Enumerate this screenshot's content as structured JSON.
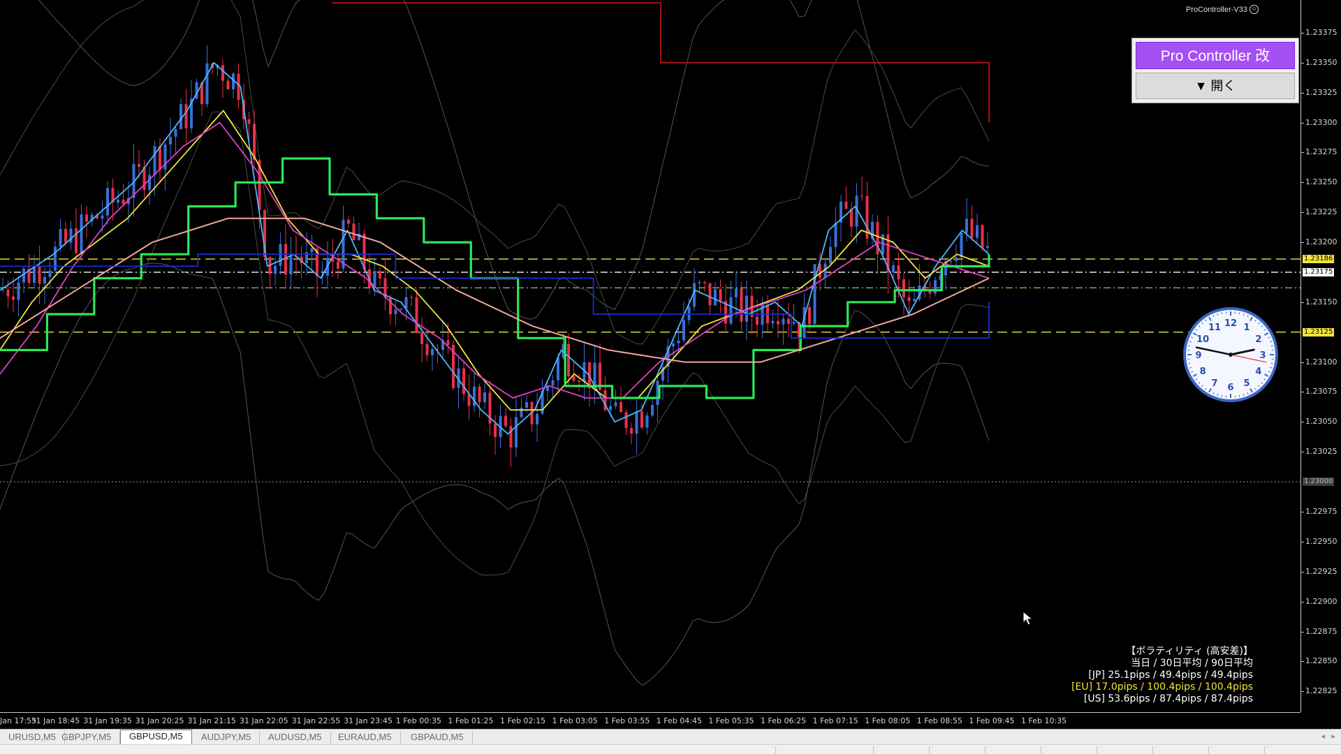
{
  "window": {
    "indicator_label": "ProController-V33",
    "current_symbol": "GBPUSD,M5"
  },
  "panel": {
    "title": "Pro Controller 改",
    "open_button": "▼ 開く",
    "title_color": "#a64ff5"
  },
  "price_axis": {
    "ticks": [
      "1.23375",
      "1.23350",
      "1.23325",
      "1.23300",
      "1.23275",
      "1.23250",
      "1.23225",
      "1.23200",
      "1.23150",
      "1.23100",
      "1.23075",
      "1.23050",
      "1.23025",
      "1.22975",
      "1.22950",
      "1.22925",
      "1.22900",
      "1.22875",
      "1.22850",
      "1.22825"
    ],
    "levels": [
      {
        "label": "1.23186",
        "color": "#f4e43c"
      },
      {
        "label": "1.23175",
        "color": "#ffffff"
      },
      {
        "label": "1.23125",
        "color": "#f4e43c"
      },
      {
        "label": "1.23000",
        "color": "#808080"
      }
    ]
  },
  "time_axis": {
    "ticks": [
      "Jan 17:55",
      "31 Jan 18:45",
      "31 Jan 19:35",
      "31 Jan 20:25",
      "31 Jan 21:15",
      "31 Jan 22:05",
      "31 Jan 22:55",
      "31 Jan 23:45",
      "1 Feb 00:35",
      "1 Feb 01:25",
      "1 Feb 02:15",
      "1 Feb 03:05",
      "1 Feb 03:55",
      "1 Feb 04:45",
      "1 Feb 05:35",
      "1 Feb 06:25",
      "1 Feb 07:15",
      "1 Feb 08:05",
      "1 Feb 08:55",
      "1 Feb 09:45",
      "1 Feb 10:35"
    ]
  },
  "tabs": [
    "URUSD,M5",
    "GBPJPY,M5",
    "GBPUSD,M5",
    "AUDJPY,M5",
    "AUDUSD,M5",
    "EURAUD,M5",
    "GBPAUD,M5"
  ],
  "active_tab": "GBPUSD,M5",
  "volatility": {
    "title": "【ボラティリティ (高安差)】",
    "header": "当日 / 30日平均 / 90日平均",
    "jp": "[JP] 25.1pips / 49.4pips / 49.4pips",
    "eu": "[EU] 17.0pips / 100.4pips / 100.4pips",
    "us": "[US] 53.6pips / 87.4pips / 87.4pips"
  },
  "clock": {
    "numbers": [
      "12",
      "1",
      "2",
      "3",
      "4",
      "5",
      "6",
      "7",
      "8",
      "9",
      "10",
      "11"
    ],
    "hour": 2.6,
    "minute": 47,
    "second": 17
  },
  "chart_data": {
    "type": "candlestick",
    "title": "GBPUSD,M5",
    "ylim": [
      1.2281,
      1.234
    ],
    "horizontal_levels": [
      {
        "price": 1.23186,
        "color": "#f4e43c",
        "style": "dashed"
      },
      {
        "price": 1.23175,
        "color": "#ffffff",
        "style": "dash-dot"
      },
      {
        "price": 1.23162,
        "color": "#7fd66e",
        "style": "dash-dot"
      },
      {
        "price": 1.23125,
        "color": "#f4e43c",
        "style": "dashed"
      },
      {
        "price": 1.23,
        "color": "#808080",
        "style": "dotted"
      }
    ],
    "bull_color": "#3a6fd8",
    "bear_color": "#e8304a",
    "series": [
      {
        "name": "ma_fast",
        "color": "#4cb8ff",
        "values": [
          1.2316,
          1.23175,
          1.2319,
          1.2321,
          1.2323,
          1.2325,
          1.2328,
          1.2331,
          1.2335,
          1.2333,
          1.2318,
          1.2319,
          1.2317,
          1.2321,
          1.2316,
          1.2315,
          1.2312,
          1.2309,
          1.2306,
          1.2304,
          1.2306,
          1.2311,
          1.2309,
          1.2305,
          1.2306,
          1.2311,
          1.2316,
          1.2315,
          1.2314,
          1.2315,
          1.2313,
          1.2321,
          1.2323,
          1.2319,
          1.2314,
          1.2318,
          1.2321,
          1.2319
        ]
      },
      {
        "name": "ma_mid",
        "color": "#f4e43c",
        "values": [
          1.2311,
          1.2315,
          1.2318,
          1.232,
          1.2322,
          1.2325,
          1.2328,
          1.2331,
          1.2327,
          1.2322,
          1.2319,
          1.2319,
          1.2318,
          1.2316,
          1.2313,
          1.2309,
          1.2306,
          1.2306,
          1.2309,
          1.2307,
          1.2307,
          1.231,
          1.2313,
          1.2314,
          1.2315,
          1.2316,
          1.2318,
          1.2321,
          1.232,
          1.2317,
          1.2319,
          1.2318
        ]
      },
      {
        "name": "ma_slow",
        "color": "#e040c8",
        "values": [
          1.2309,
          1.2313,
          1.2318,
          1.2322,
          1.2325,
          1.2328,
          1.233,
          1.2326,
          1.2321,
          1.2319,
          1.2317,
          1.2314,
          1.2312,
          1.2309,
          1.2307,
          1.2308,
          1.2307,
          1.2307,
          1.231,
          1.2312,
          1.2314,
          1.2315,
          1.2316,
          1.2318,
          1.232,
          1.2319,
          1.2318,
          1.2317
        ]
      },
      {
        "name": "stepline",
        "color": "#2be85a",
        "values": [
          1.2311,
          1.2314,
          1.2317,
          1.2319,
          1.2323,
          1.2325,
          1.2327,
          1.2324,
          1.2322,
          1.232,
          1.2317,
          1.2312,
          1.2308,
          1.2307,
          1.2308,
          1.2307,
          1.2311,
          1.2313,
          1.2315,
          1.2316,
          1.2318,
          1.2319
        ]
      },
      {
        "name": "long_ma",
        "color": "#f0a898",
        "values": [
          1.2312,
          1.2316,
          1.232,
          1.2322,
          1.2322,
          1.232,
          1.2316,
          1.2313,
          1.2311,
          1.231,
          1.231,
          1.2312,
          1.2314,
          1.2317
        ]
      },
      {
        "name": "resistance",
        "color": "#b41414",
        "values": [
          1.234,
          1.2335,
          1.233
        ]
      },
      {
        "name": "support_line",
        "color": "#1a2ecc",
        "values": [
          1.2318,
          1.2319,
          1.2317,
          1.2314,
          1.2312,
          1.2315
        ]
      }
    ]
  }
}
